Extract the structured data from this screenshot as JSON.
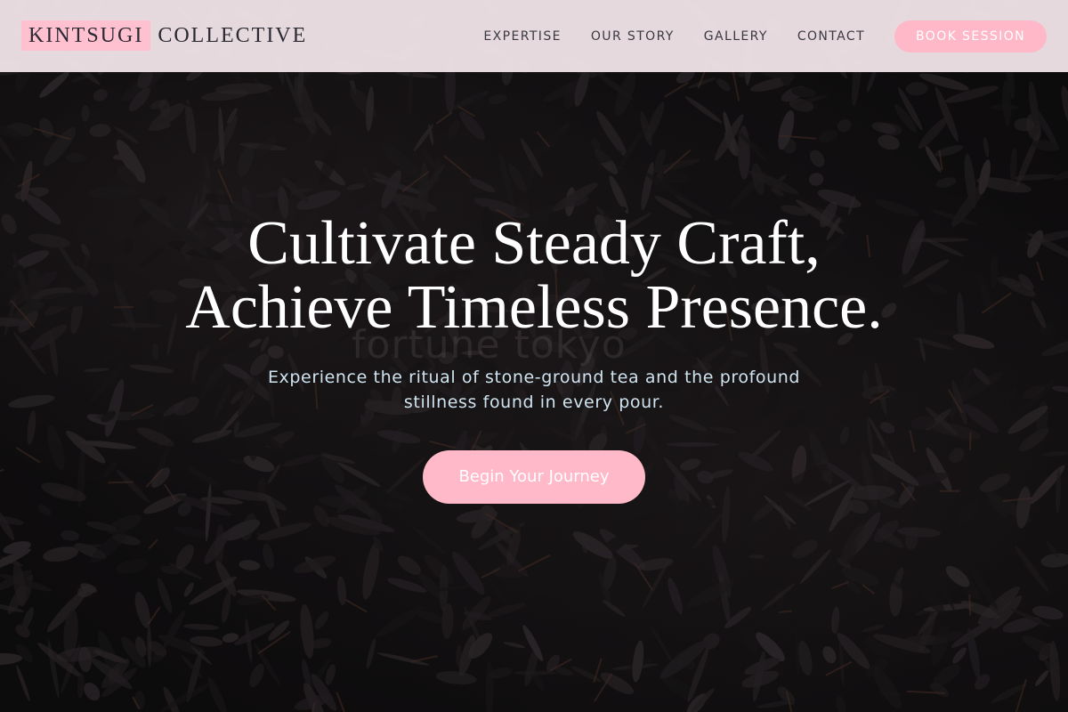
{
  "brand": {
    "mark": "KINTSUGI",
    "rest": "COLLECTIVE",
    "accent_color": "#ffc0cf"
  },
  "nav": {
    "links": [
      {
        "label": "EXPERTISE"
      },
      {
        "label": "OUR STORY"
      },
      {
        "label": "GALLERY"
      },
      {
        "label": "CONTACT"
      }
    ],
    "cta_label": "BOOK SESSION"
  },
  "hero": {
    "title_line1": "Cultivate Steady Craft,",
    "title_line2": "Achieve Timeless Presence.",
    "subtitle": "Experience the ritual of stone-ground tea and the profound stillness found in every pour.",
    "button_label": "Begin Your Journey",
    "watermark": "fortune tokyo",
    "background": "dark-tea-leaves-image"
  }
}
